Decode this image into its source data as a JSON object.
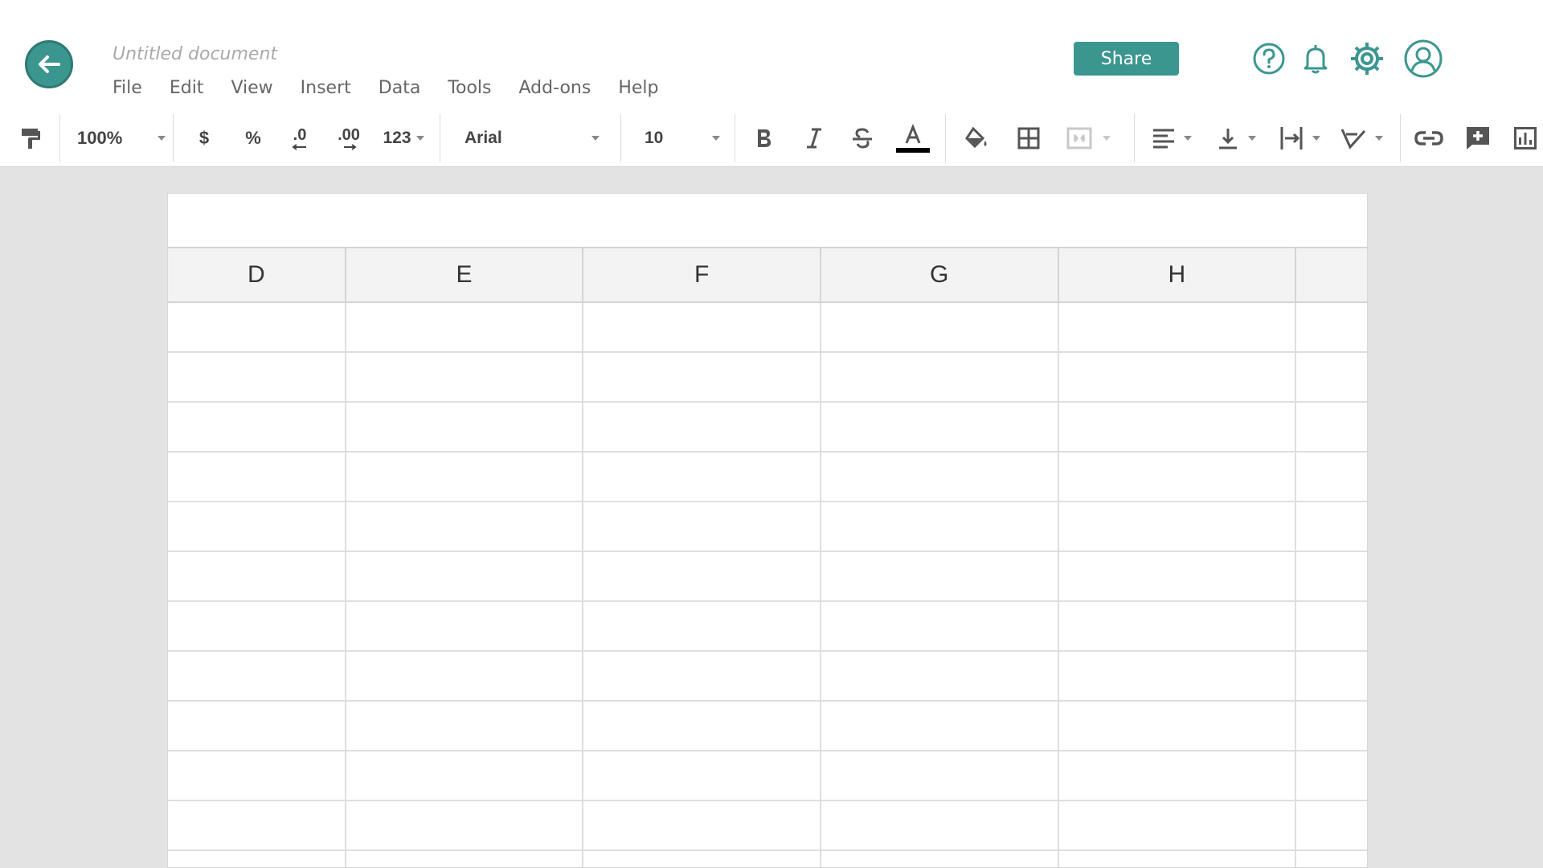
{
  "header": {
    "doc_title": "Untitled document",
    "share_label": "Share",
    "accent_color": "#3c9690",
    "menu": [
      "File",
      "Edit",
      "View",
      "Insert",
      "Data",
      "Tools",
      "Add-ons",
      "Help"
    ],
    "icons": [
      "back-arrow-icon",
      "help-icon",
      "bell-icon",
      "gear-icon",
      "account-icon"
    ]
  },
  "toolbar": {
    "zoom": "100%",
    "currency": "$",
    "percent": "%",
    "decrease_decimals": ".0",
    "increase_decimals": ".00",
    "more_formats": "123",
    "font": "Arial",
    "font_size": "10"
  },
  "sheet": {
    "columns": [
      "D",
      "E",
      "F",
      "G",
      "H",
      ""
    ]
  }
}
